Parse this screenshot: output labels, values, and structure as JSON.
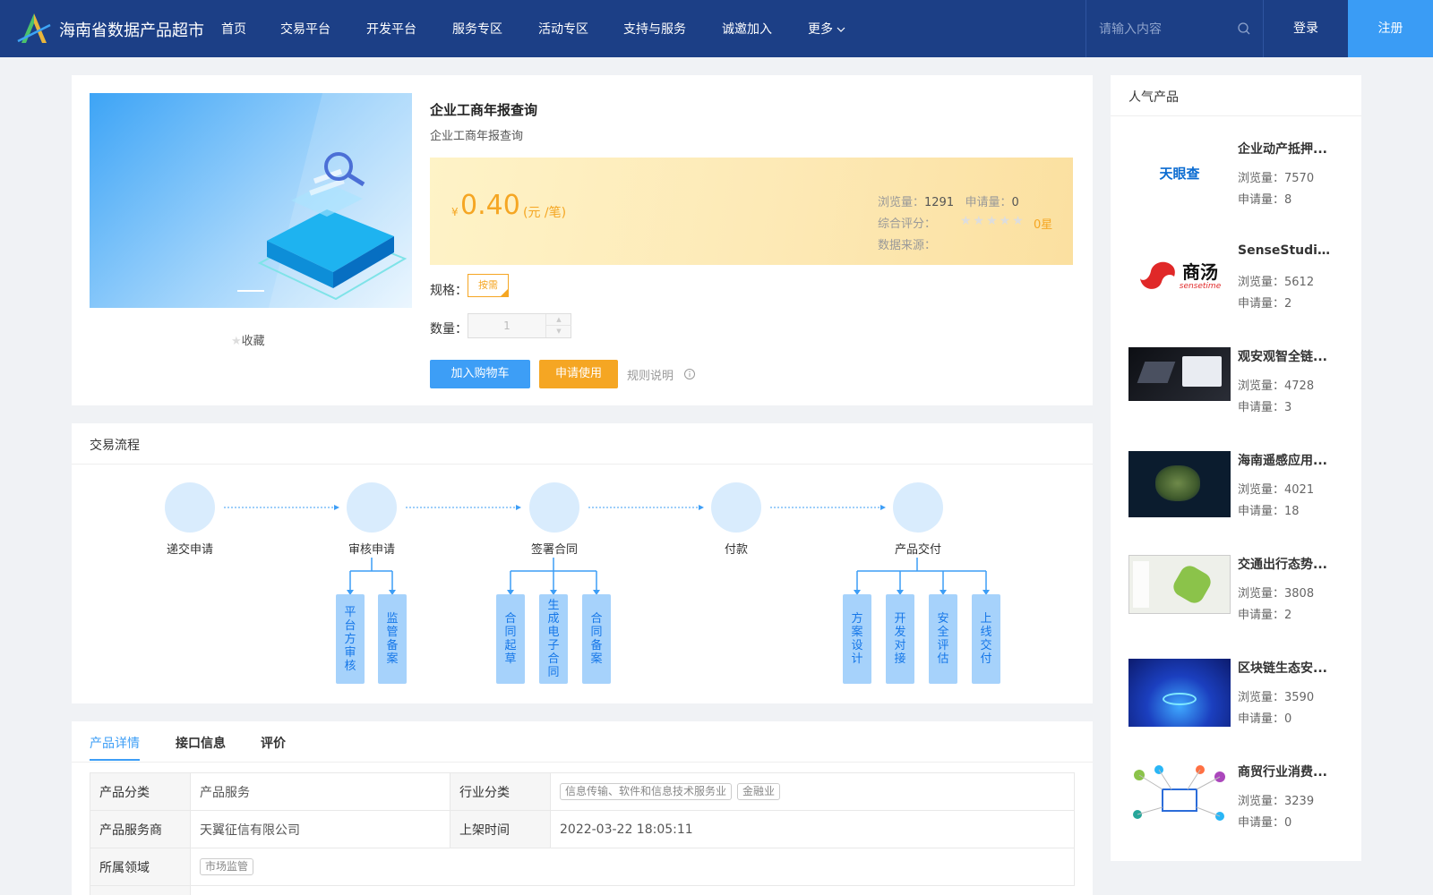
{
  "header": {
    "brand": "海南省数据产品超市",
    "nav": [
      "首页",
      "交易平台",
      "开发平台",
      "服务专区",
      "活动专区",
      "支持与服务",
      "诚邀加入",
      "更多"
    ],
    "search_placeholder": "请输入内容",
    "login": "登录",
    "register": "注册"
  },
  "product": {
    "title": "企业工商年报查询",
    "subtitle": "企业工商年报查询",
    "favorite": "收藏",
    "currency": "¥",
    "price": "0.40",
    "unit": "(元 /笔)",
    "views_label": "浏览量：",
    "views": "1291",
    "applies_label": "申请量：",
    "applies": "0",
    "rating_label": "综合评分：",
    "rating": "0星",
    "rating_stars": 0,
    "source_label": "数据来源：",
    "spec_label": "规格：",
    "spec_value": "按需",
    "qty_label": "数量：",
    "qty_value": "1",
    "add_cart": "加入购物车",
    "apply": "申请使用",
    "rules": "规则说明"
  },
  "flow": {
    "title": "交易流程",
    "steps": [
      "递交申请",
      "审核申请",
      "签署合同",
      "付款",
      "产品交付"
    ],
    "sub": {
      "review": [
        "平台方审核",
        "监管备案"
      ],
      "contract": [
        "合同起草",
        "生成电子合同",
        "合同备案"
      ],
      "delivery": [
        "方案设计",
        "开发对接",
        "安全评估",
        "上线交付"
      ]
    }
  },
  "details": {
    "tabs": [
      "产品详情",
      "接口信息",
      "评价"
    ],
    "rows": [
      {
        "k1": "产品分类",
        "v1": "产品服务",
        "k2": "行业分类",
        "tags": [
          "信息传输、软件和信息技术服务业",
          "金融业"
        ]
      },
      {
        "k1": "产品服务商",
        "v1": "天翼征信有限公司",
        "k2": "上架时间",
        "v2": "2022-03-22 18:05:11"
      },
      {
        "k1": "所属领域",
        "tags": [
          "市场监管"
        ]
      }
    ]
  },
  "popular": {
    "title": "人气产品",
    "views_label": "浏览量：",
    "applies_label": "申请量：",
    "items": [
      {
        "name": "企业动产抵押...",
        "views": "7570",
        "applies": "8",
        "logo_text": "天眼查"
      },
      {
        "name": "SenseStudio...",
        "views": "5612",
        "applies": "2",
        "logo_text": "商汤",
        "logo_sub": "sensetime"
      },
      {
        "name": "观安观智全链...",
        "views": "4728",
        "applies": "3"
      },
      {
        "name": "海南遥感应用...",
        "views": "4021",
        "applies": "18"
      },
      {
        "name": "交通出行态势...",
        "views": "3808",
        "applies": "2"
      },
      {
        "name": "区块链生态安...",
        "views": "3590",
        "applies": "0"
      },
      {
        "name": "商贸行业消费...",
        "views": "3239",
        "applies": "0"
      }
    ]
  },
  "colors": {
    "header": "#1c3f86",
    "accent": "#3d9ef6",
    "orange": "#f5a623"
  }
}
